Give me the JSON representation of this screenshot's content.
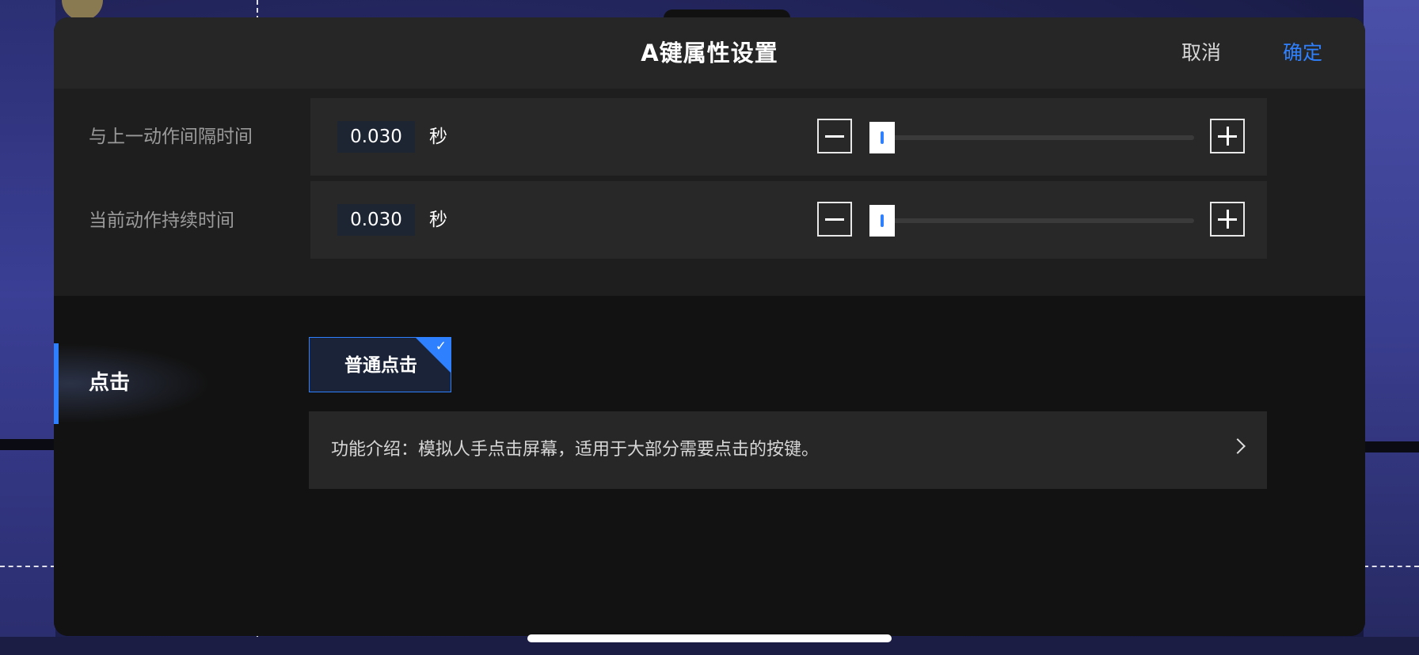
{
  "dialog": {
    "title": "A键属性设置",
    "cancel_label": "取消",
    "confirm_label": "确定"
  },
  "timing": {
    "rows": [
      {
        "label": "与上一动作间隔时间",
        "value": "0.030",
        "unit": "秒",
        "slider_fraction": 0.0
      },
      {
        "label": "当前动作持续时间",
        "value": "0.030",
        "unit": "秒",
        "slider_fraction": 0.0
      }
    ]
  },
  "mode": {
    "tab_label": "点击",
    "option_label": "普通点击",
    "option_selected": true,
    "description": "功能介绍：模拟人手点击屏幕，适用于大部分需要点击的按键。"
  },
  "colors": {
    "accent": "#2f80ff",
    "dialog_bg": "#121212",
    "header_bg": "#262626"
  },
  "icons": {
    "minus": "minus-icon",
    "plus": "plus-icon",
    "check": "check-icon",
    "chevron": "chevron-right-icon"
  }
}
